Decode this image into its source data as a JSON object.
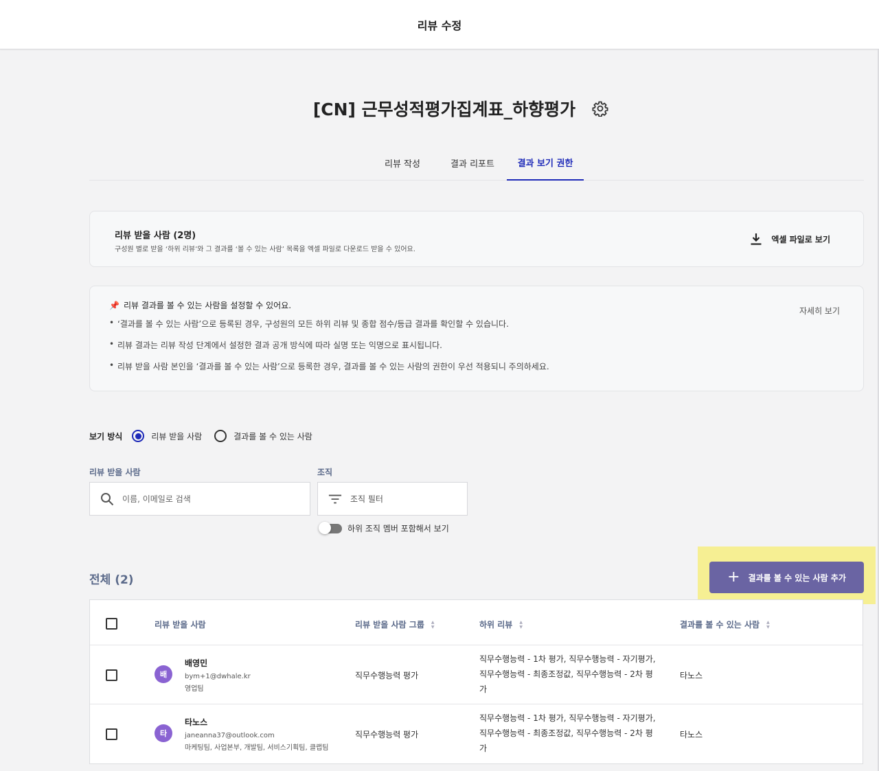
{
  "header": {
    "title": "리뷰 수정"
  },
  "page": {
    "title": "[CN] 근무성적평가집계표_하향평가"
  },
  "tabs": [
    {
      "label": "리뷰 작성",
      "active": false
    },
    {
      "label": "결과 리포트",
      "active": false
    },
    {
      "label": "결과 보기 권한",
      "active": true
    }
  ],
  "reviewee_card": {
    "title": "리뷰 받을 사람 (2명)",
    "description": "구성원 별로 받을 ‘하위 리뷰’와 그 결과를 ‘볼 수 있는 사람’ 목록을 엑셀 파일로 다운로드 받을 수 있어요.",
    "excel_label": "엑셀 파일로 보기"
  },
  "info_card": {
    "heading": "리뷰 결과를 볼 수 있는 사람을 설정할 수 있어요.",
    "bullets": [
      "‘결과를 볼 수 있는 사람’으로 등록된 경우, 구성원의 모든 하위 리뷰 및 종합 점수/등급 결과를 확인할 수 있습니다.",
      "리뷰 결과는 리뷰 작성 단계에서 설정한 결과 공개 방식에 따라 실명 또는 익명으로 표시됩니다.",
      "리뷰 받을 사람 본인을 ‘결과를 볼 수 있는 사람’으로 등록한 경우, 결과를 볼 수 있는 사람의 권한이 우선 적용되니 주의하세요."
    ],
    "detail_link": "자세히 보기"
  },
  "view_mode": {
    "label": "보기 방식",
    "options": [
      "리뷰 받을 사람",
      "결과를 볼 수 있는 사람"
    ],
    "selected": 0
  },
  "filters": {
    "reviewee_label": "리뷰 받을 사람",
    "search_placeholder": "이름, 이메일로 검색",
    "org_label": "조직",
    "org_filter_label": "조직 필터",
    "toggle_label": "하위 조직 멤버 포함해서 보기",
    "toggle_on": false
  },
  "list": {
    "total_label": "전체 (2)",
    "add_button": "결과를 볼 수 있는 사람 추가",
    "columns": [
      "리뷰 받을 사람",
      "리뷰 받을 사람 그룹",
      "하위 리뷰",
      "결과를 볼 수 있는 사람"
    ],
    "rows": [
      {
        "avatar": "배",
        "name": "배영민",
        "email": "bym+1@dwhale.kr",
        "team": "영업팀",
        "group": "직무수행능력 평가",
        "sub_reviews": "직무수행능력 - 1차 평가, 직무수행능력 - 자기평가, 직무수행능력 - 최종조정값, 직무수행능력 - 2차 평가",
        "viewers": "타노스"
      },
      {
        "avatar": "타",
        "name": "타노스",
        "email": "janeanna37@outlook.com",
        "team": "마케팅팀, 사업본부, 개발팀, 서비스기획팀, 클랩팀",
        "group": "직무수행능력 평가",
        "sub_reviews": "직무수행능력 - 1차 평가, 직무수행능력 - 자기평가, 직무수행능력 - 최종조정값, 직무수행능력 - 2차 평가",
        "viewers": "타노스"
      }
    ]
  },
  "colors": {
    "accent": "#1e2ab8",
    "add_button": "#6a64a3",
    "highlight": "#f6ef93",
    "avatar": "#8a63d2"
  }
}
